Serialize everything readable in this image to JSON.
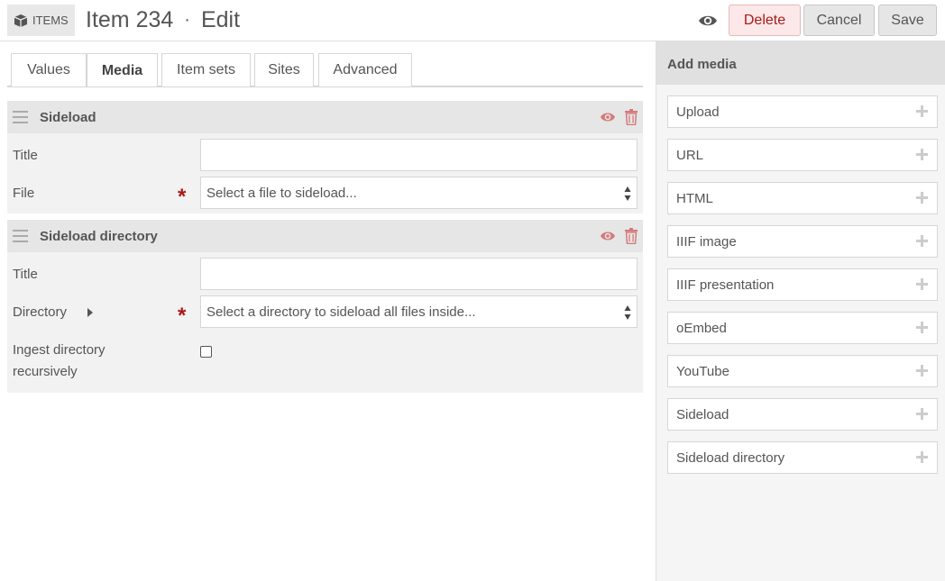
{
  "header": {
    "badge_label": "ITEMS",
    "title": "Item 234",
    "separator": "·",
    "subtitle": "Edit",
    "delete_label": "Delete",
    "cancel_label": "Cancel",
    "save_label": "Save"
  },
  "tabs": [
    {
      "label": "Values",
      "active": false
    },
    {
      "label": "Media",
      "active": true
    },
    {
      "label": "Item sets",
      "active": false
    },
    {
      "label": "Sites",
      "active": false
    },
    {
      "label": "Advanced",
      "active": false
    }
  ],
  "blocks": [
    {
      "title": "Sideload",
      "title_field_label": "Title",
      "file_label": "File",
      "file_placeholder": "Select a file to sideload..."
    },
    {
      "title": "Sideload directory",
      "title_field_label": "Title",
      "directory_label": "Directory",
      "directory_placeholder": "Select a directory to sideload all files inside...",
      "recursive_label_line1": "Ingest directory",
      "recursive_label_line2": "recursively"
    }
  ],
  "required_mark": "*",
  "sidebar": {
    "title": "Add media",
    "items": [
      "Upload",
      "URL",
      "HTML",
      "IIIF image",
      "IIIF presentation",
      "oEmbed",
      "YouTube",
      "Sideload",
      "Sideload directory"
    ]
  },
  "colors": {
    "accent_red": "#a91919",
    "icon_red": "#d47a7a"
  }
}
